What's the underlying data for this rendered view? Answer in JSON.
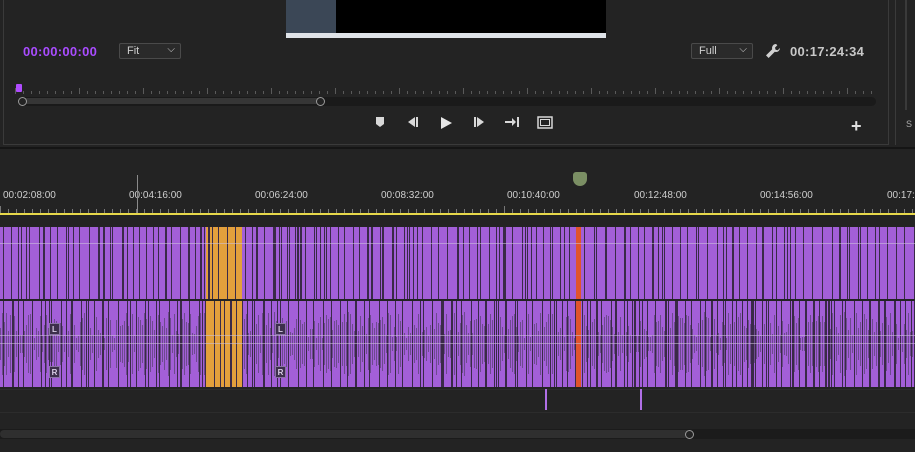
{
  "program_monitor": {
    "current_timecode": "00:00:00:00",
    "duration_timecode": "00:17:24:34",
    "zoom_select": "Fit",
    "resolution_select": "Full",
    "controls": {
      "add_marker": "add-marker-icon",
      "step_back": "step-back-icon",
      "play": "play-icon",
      "step_forward": "step-forward-icon",
      "insert": "insert-icon",
      "export_frame": "export-frame-icon",
      "add_button": "+"
    },
    "side_panel_label": "S"
  },
  "timeline": {
    "ruler_labels": [
      "00:02:08:00",
      "00:04:16:00",
      "00:06:24:00",
      "00:08:32:00",
      "00:10:40:00",
      "00:12:48:00",
      "00:14:56:00",
      "00:17:"
    ],
    "audio_channels": [
      "L",
      "R"
    ]
  },
  "colors": {
    "clip": "#a35fd8",
    "selected_clip": "#e3a03c",
    "timecode_accent": "#a94cff",
    "work_area": "#e7d84a",
    "current_time_line": "#e0542c"
  }
}
